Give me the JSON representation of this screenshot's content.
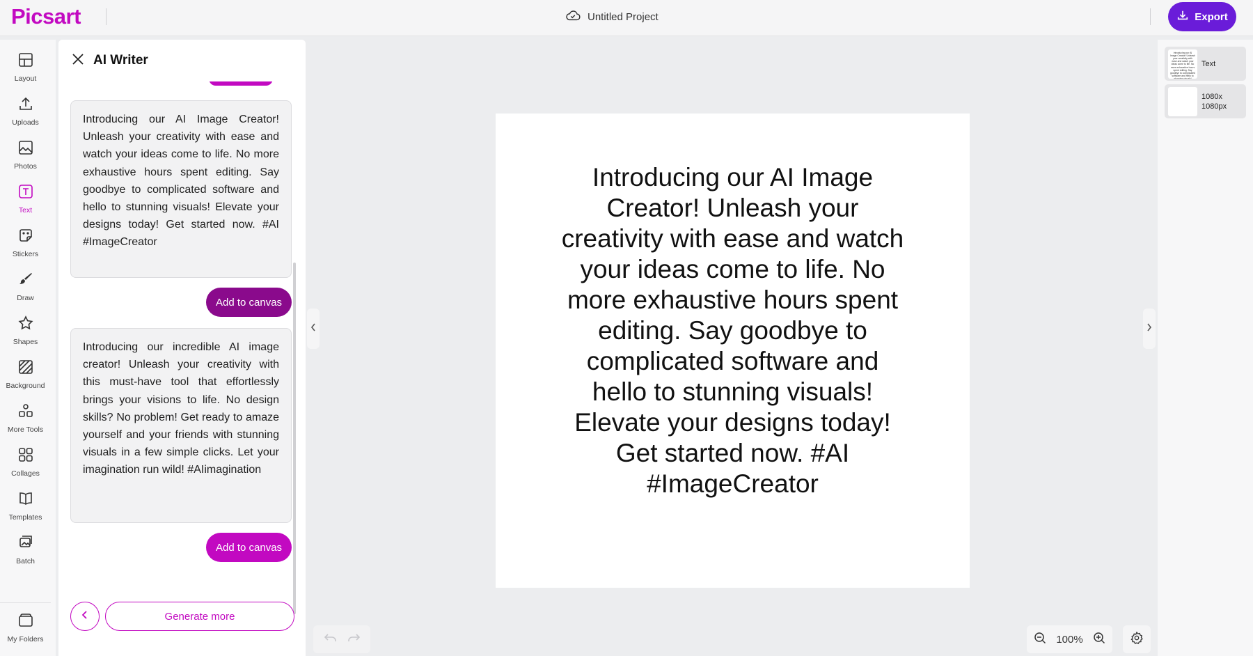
{
  "app": {
    "brand": "Picsart",
    "project_title": "Untitled Project",
    "export_label": "Export",
    "accent": "#c209c1",
    "export_color": "#6a1cd9"
  },
  "rail": {
    "items": [
      {
        "label": "Layout",
        "icon": "layout-icon"
      },
      {
        "label": "Uploads",
        "icon": "upload-icon"
      },
      {
        "label": "Photos",
        "icon": "image-icon"
      },
      {
        "label": "Text",
        "icon": "text-icon",
        "active": true
      },
      {
        "label": "Stickers",
        "icon": "sticker-icon"
      },
      {
        "label": "Draw",
        "icon": "brush-icon"
      },
      {
        "label": "Shapes",
        "icon": "star-icon"
      },
      {
        "label": "Background",
        "icon": "background-icon"
      },
      {
        "label": "More Tools",
        "icon": "more-tools-icon"
      },
      {
        "label": "Collages",
        "icon": "collage-icon"
      },
      {
        "label": "Templates",
        "icon": "book-icon"
      },
      {
        "label": "Batch",
        "icon": "batch-icon"
      }
    ],
    "folders_label": "My Folders"
  },
  "panel": {
    "title": "AI Writer",
    "results": [
      {
        "text": "Introducing our AI Image Creator! Unleash your creativity with ease and watch your ideas come to life. No more exhaustive hours spent editing. Say goodbye to complicated software and hello to stunning visuals! Elevate your designs today! Get started now. #AI #ImageCreator",
        "button_label": "Add to canvas",
        "button_color": "#8a0a8c"
      },
      {
        "text": "Introducing our incredible AI image creator! Unleash your creativity with this must-have tool that effortlessly brings your visions to life. No design skills? No problem! Get ready to amaze yourself and your friends with stunning visuals in a few simple clicks. Let your imagination run wild! #AIimagination",
        "button_label": "Add to canvas",
        "button_color": "#c209c1"
      }
    ],
    "generate_more_label": "Generate more"
  },
  "canvas": {
    "text": "Introducing our AI Image Creator! Unleash your creativity with ease and watch your ideas come to life. No more exhaustive hours spent editing. Say goodbye to complicated software and hello to stunning visuals! Elevate your designs today! Get started now. #AI #ImageCreator",
    "zoom": "100%"
  },
  "layers": {
    "items": [
      {
        "label": "Text"
      },
      {
        "label": "1080x\n1080px"
      }
    ]
  }
}
